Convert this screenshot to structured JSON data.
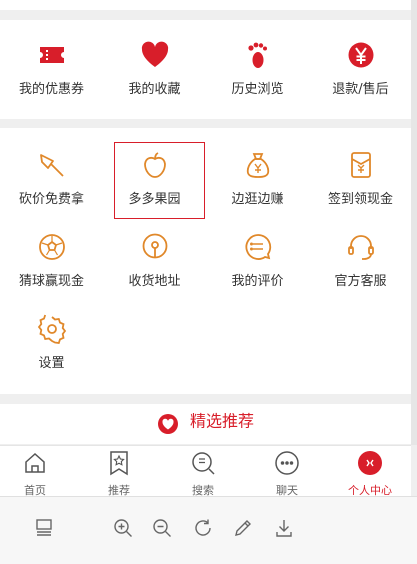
{
  "order_row": [
    {
      "label": "我的优惠券",
      "icon": "ticket-icon"
    },
    {
      "label": "我的收藏",
      "icon": "heart-icon"
    },
    {
      "label": "历史浏览",
      "icon": "footprint-icon"
    },
    {
      "label": "退款/售后",
      "icon": "yen-circle-icon"
    }
  ],
  "services": [
    {
      "label": "砍价免费拿",
      "icon": "axe-icon"
    },
    {
      "label": "多多果园",
      "icon": "apple-icon"
    },
    {
      "label": "边逛边赚",
      "icon": "money-bag-icon"
    },
    {
      "label": "签到领现金",
      "icon": "red-envelope-icon"
    },
    {
      "label": "猜球赢现金",
      "icon": "football-icon"
    },
    {
      "label": "收货地址",
      "icon": "location-icon"
    },
    {
      "label": "我的评价",
      "icon": "comment-icon"
    },
    {
      "label": "官方客服",
      "icon": "headset-icon"
    },
    {
      "label": "设置",
      "icon": "settings-icon"
    }
  ],
  "recommend": {
    "label": "精选推荐"
  },
  "tabs": [
    {
      "label": "首页",
      "icon": "home-icon"
    },
    {
      "label": "推荐",
      "icon": "bookmark-icon"
    },
    {
      "label": "搜索",
      "icon": "search-icon"
    },
    {
      "label": "聊天",
      "icon": "chat-icon"
    },
    {
      "label": "个人中心",
      "icon": "profile-icon",
      "active": true
    }
  ],
  "toolbar": [
    "layout-icon",
    "zoom-in-icon",
    "zoom-out-icon",
    "rotate-icon",
    "edit-icon",
    "download-icon"
  ],
  "colors": {
    "brand_red": "#d81e2a",
    "orange": "#e0882a",
    "background": "#efefef"
  }
}
